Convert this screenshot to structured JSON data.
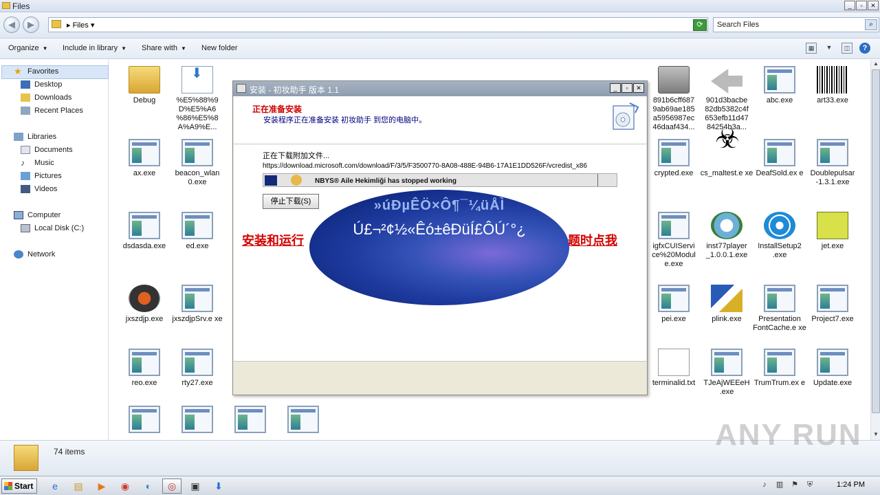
{
  "window": {
    "title": "Files"
  },
  "address": {
    "crumb": "Files",
    "search_placeholder": "Search Files"
  },
  "toolbar": {
    "organize": "Organize",
    "include": "Include in library",
    "share": "Share with",
    "new_folder": "New folder"
  },
  "nav": {
    "favorites": "Favorites",
    "desktop": "Desktop",
    "downloads": "Downloads",
    "recent": "Recent Places",
    "libraries": "Libraries",
    "documents": "Documents",
    "music": "Music",
    "pictures": "Pictures",
    "videos": "Videos",
    "computer": "Computer",
    "local_disk": "Local Disk (C:)",
    "network": "Network"
  },
  "files": {
    "debug": "Debug",
    "encoded": "%E5%88%9 D%E5%A6 %86%E5%8 A%A9%E...",
    "h891": "891b6cff687 9ab69ae185 a5956987ec 46daaf434...",
    "h901": "901d3bacbe 82db5382c4f 653efb11d47 84254b3a...",
    "abc": "abc.exe",
    "art33": "art33.exe",
    "ax": "ax.exe",
    "beacon": "beacon_wlan 0.exe",
    "crypted": "crypted.exe",
    "cs_maltest": "cs_maltest.e xe",
    "deafsold": "DeafSold.ex e",
    "doublepulsar": "Doublepulsar -1.3.1.exe",
    "dsdasda": "dsdasda.exe",
    "ed": "ed.exe",
    "igfx": "igfxCUIServi ce%20Modul e.exe",
    "inst77": "inst77player _1.0.0.1.exe",
    "installsetup": "InstallSetup2 .exe",
    "jet": "jet.exe",
    "jxszdjp": "jxszdjp.exe",
    "jxszdjpsrv": "jxszdjpSrv.e xe",
    "pei": "pei.exe",
    "plink": "plink.exe",
    "presentation": "Presentation FontCache.e xe",
    "project7": "Project7.exe",
    "reo": "reo.exe",
    "rty27": "rty27.exe",
    "terminalid": "terminalid.txt",
    "tjeaj": "TJeAjWEEeH .exe",
    "trumtrum": "TrumTrum.ex e",
    "update": "Update.exe"
  },
  "details": {
    "count": "74 items"
  },
  "watermark": "ANY RUN",
  "dialog": {
    "title": "安装 - 初妆助手 版本 1.1",
    "heading": "正在准备安装",
    "subheading": "安装程序正在准备安装 初妆助手 到您的电脑中。",
    "downloading": "正在下载附加文件...",
    "url": "https://download.microsoft.com/download/F/3/5/F3500770-8A08-488E-94B6-17A1E1DD526F/vcredist_x86",
    "error_msg": "NBYS® Aile Hekimliği has stopped working",
    "stop_button": "停止下载(S)"
  },
  "overlay": {
    "red_left": "安装和运行",
    "red_right": "题时点我",
    "garbled1": "»úÐµÊÖ×Ô¶¯¼üÅÌ",
    "garbled2": "Ú£¬²¢½«Êó±êÐüÍ£ÔÚ´°¿"
  },
  "taskbar": {
    "start": "Start",
    "clock": "1:24 PM"
  }
}
